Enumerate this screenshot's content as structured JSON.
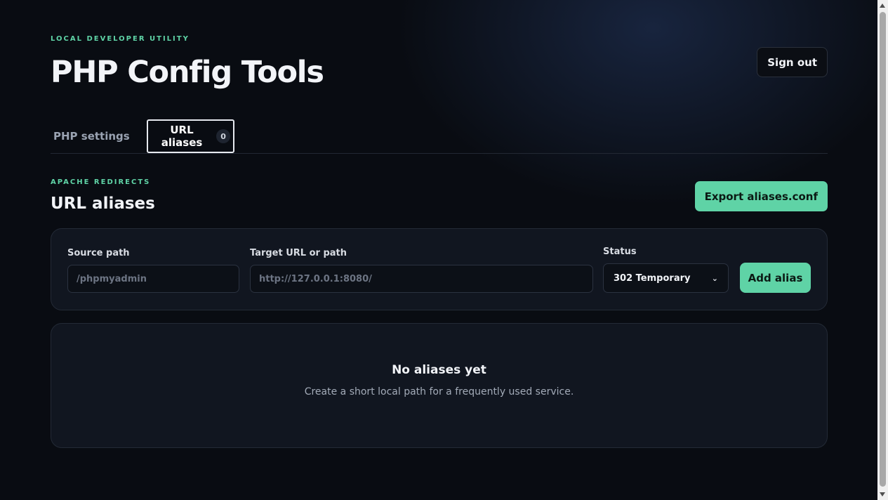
{
  "header": {
    "eyebrow": "LOCAL DEVELOPER UTILITY",
    "title": "PHP Config Tools",
    "sign_out_label": "Sign out"
  },
  "tabs": [
    {
      "label": "PHP settings",
      "active": false
    },
    {
      "label": "URL aliases",
      "active": true,
      "count": "0"
    }
  ],
  "section": {
    "eyebrow": "APACHE REDIRECTS",
    "title": "URL aliases",
    "export_label": "Export aliases.conf"
  },
  "form": {
    "source_label": "Source path",
    "source_placeholder": "/phpmyadmin",
    "target_label": "Target URL or path",
    "target_placeholder": "http://127.0.0.1:8080/",
    "status_label": "Status",
    "status_value": "302 Temporary",
    "add_label": "Add alias"
  },
  "empty_state": {
    "title": "No aliases yet",
    "description": "Create a short local path for a frequently used service."
  },
  "colors": {
    "accent": "#5fd3a6",
    "background": "#090c12",
    "card": "#111620"
  },
  "icons": {
    "status_dropdown": "chevron-down-icon"
  }
}
